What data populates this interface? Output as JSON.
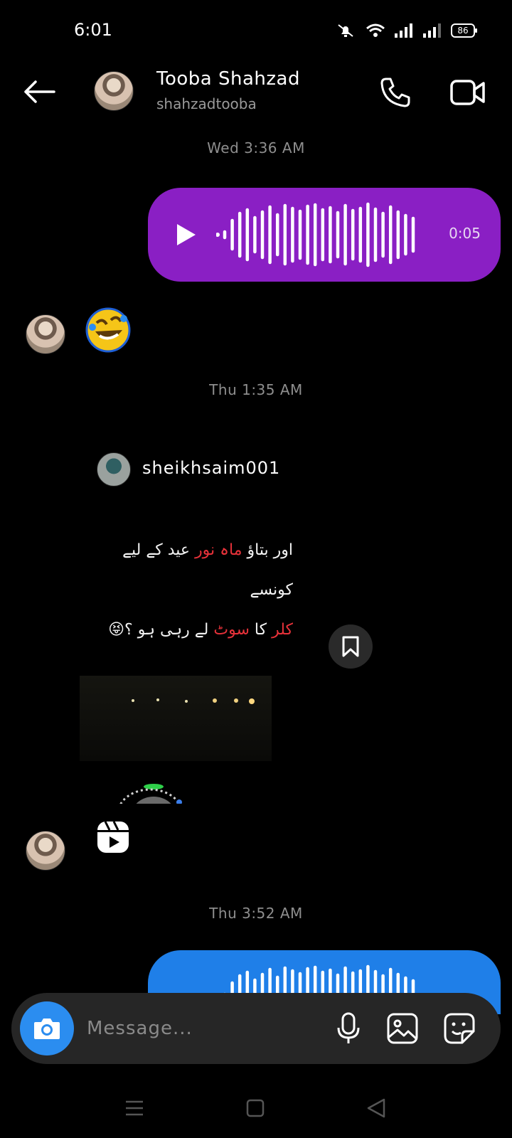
{
  "status_bar": {
    "time": "6:01",
    "battery": "86"
  },
  "header": {
    "name": "Tooba Shahzad",
    "username": "shahzadtooba"
  },
  "timestamps": [
    "Wed 3:36 AM",
    "Thu 1:35 AM",
    "Thu 3:52 AM"
  ],
  "messages": {
    "voice_1": {
      "duration": "0:05",
      "color": "#8a1fc4"
    },
    "voice_2": {
      "color": "#1f7fe8"
    },
    "reel": {
      "owner": "sheikhsaim001",
      "caption_line1_a": "اور بتاؤ",
      "caption_line1_red": "ماہ نور",
      "caption_line1_b": "عید کے لیے کونسے",
      "caption_line2_red_a": "کلر",
      "caption_line2_a": "کا",
      "caption_line2_red_b": "سوٹ",
      "caption_line2_b": "لے رہی ہو ؟😝"
    }
  },
  "composer": {
    "placeholder": "Message..."
  },
  "icons": {
    "back": "arrow-left-icon",
    "call": "phone-icon",
    "video": "video-camera-icon",
    "camera": "camera-icon",
    "mic": "microphone-icon",
    "gallery": "image-icon",
    "sticker": "sticker-icon",
    "reel": "reels-icon",
    "save": "bookmark-icon"
  }
}
